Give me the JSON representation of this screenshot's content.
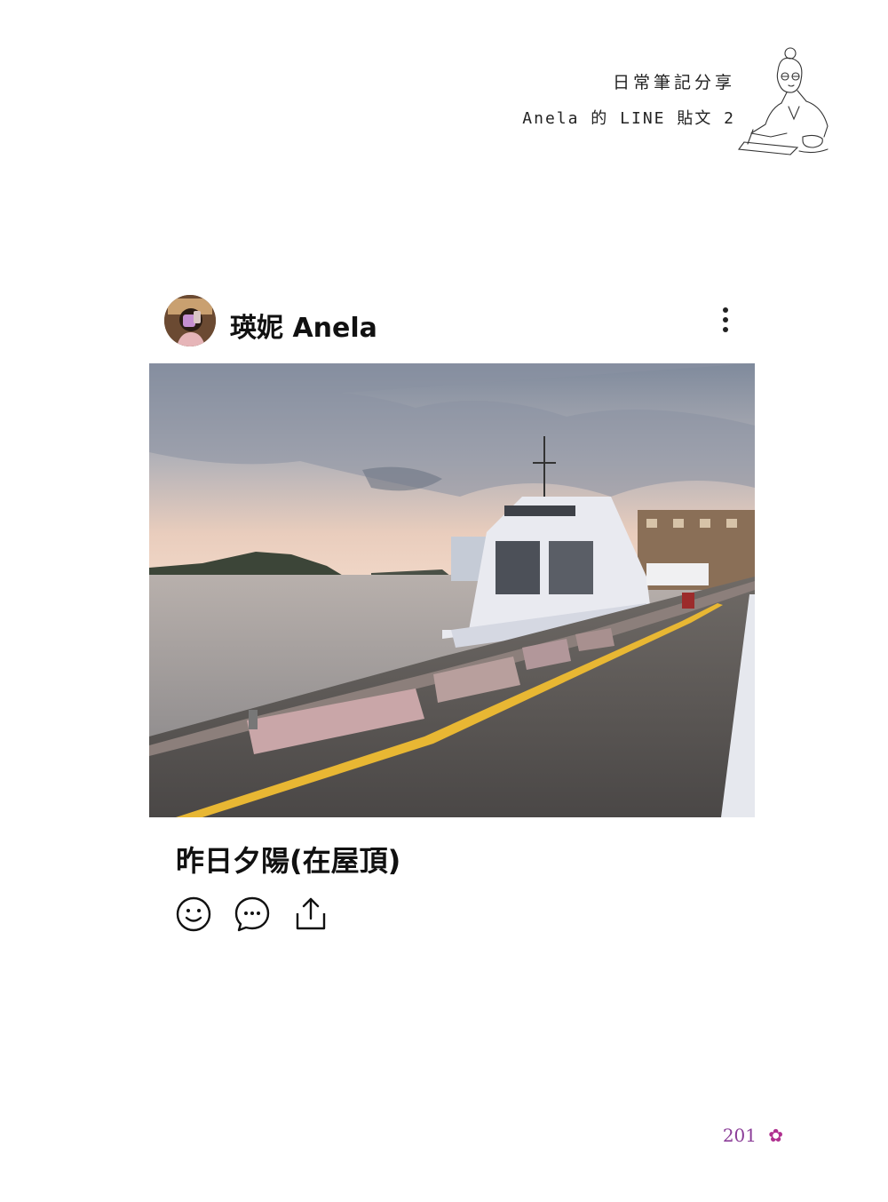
{
  "header": {
    "line1": "日常筆記分享",
    "line2": "Anela 的 LINE 貼文 2"
  },
  "post": {
    "username": "瑛妮 Anela",
    "caption": "昨日夕陽(在屋頂)",
    "icons": [
      "avatar-photo",
      "more-options-icon",
      "harbor-sunset-photo",
      "smile-icon",
      "comment-icon",
      "share-icon"
    ]
  },
  "footer": {
    "page_number": "201",
    "flower_glyph": "✿"
  },
  "colors": {
    "page_number": "#8b3d98",
    "flower": "#b0308f"
  }
}
